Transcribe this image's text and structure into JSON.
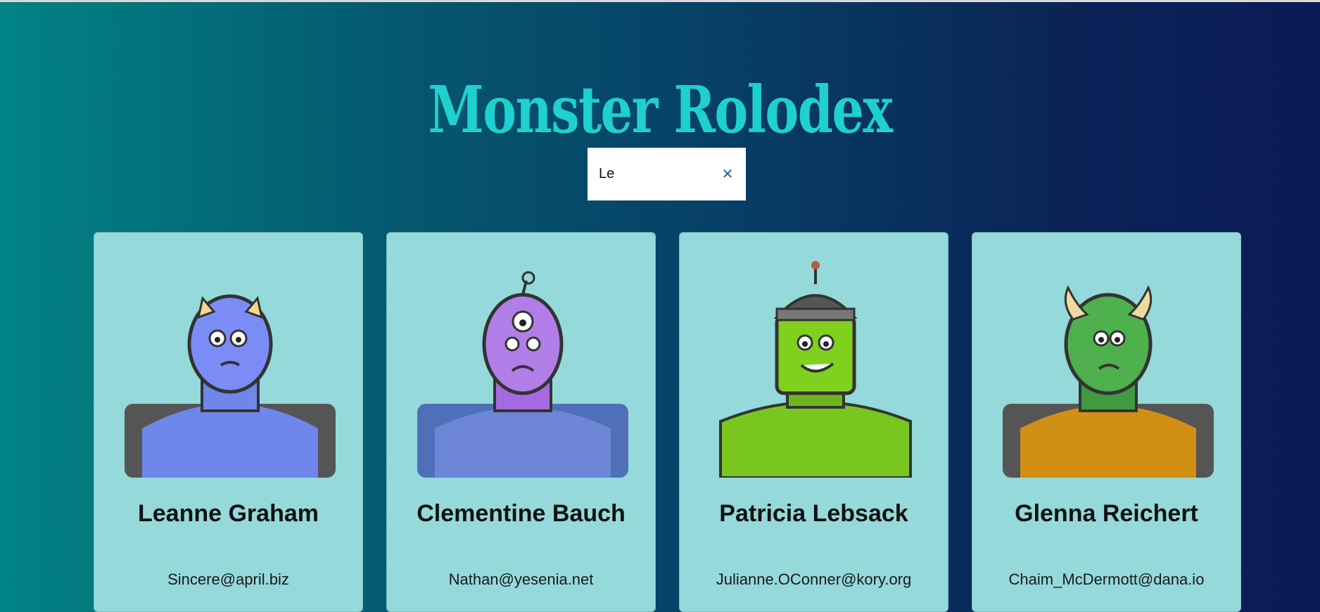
{
  "app": {
    "title": "Monster Rolodex"
  },
  "search": {
    "value": "Le",
    "clear_icon": "close-icon",
    "clear_glyph": "✕"
  },
  "cards": [
    {
      "name": "Leanne Graham",
      "email": "Sincere@april.biz",
      "avatar": "horned-blue-monster",
      "color": "#7b8cf7"
    },
    {
      "name": "Clementine Bauch",
      "email": "Nathan@yesenia.net",
      "avatar": "cyclops-purple-monster",
      "color": "#b07ee6"
    },
    {
      "name": "Patricia Lebsack",
      "email": "Julianne.OConner@kory.org",
      "avatar": "robot-helmet-green-monster",
      "color": "#80d01e"
    },
    {
      "name": "Glenna Reichert",
      "email": "Chaim_McDermott@dana.io",
      "avatar": "horned-green-monster",
      "color": "#4fb04e"
    }
  ]
}
